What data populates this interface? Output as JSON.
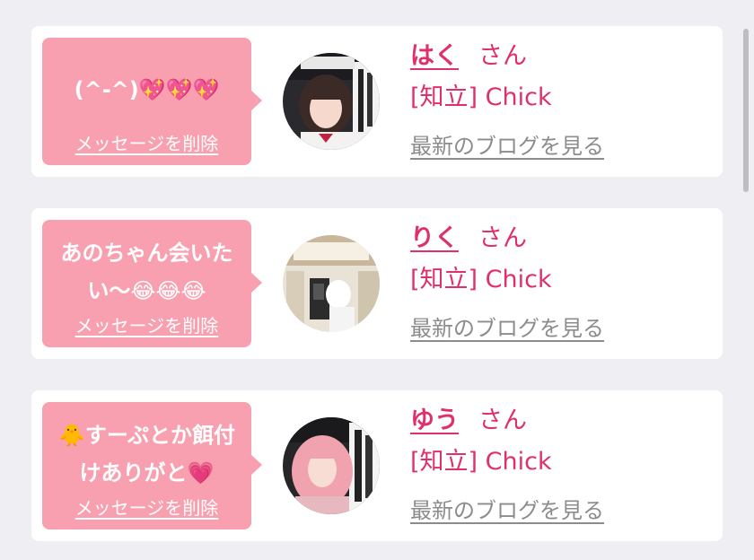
{
  "messages": [
    {
      "text": "(^-^)💖💖💖",
      "delete_label": "メッセージを削除",
      "name": "はく",
      "honorific": "さん",
      "shop": "[知立] Chick",
      "blog_label": "最新のブログを見る",
      "avatar_icon": "girl-portrait-photo"
    },
    {
      "text": "あのちゃん会いたい〜😂😂😂",
      "delete_label": "メッセージを削除",
      "name": "りく",
      "honorific": "さん",
      "shop": "[知立] Chick",
      "blog_label": "最新のブログを見る",
      "avatar_icon": "mirror-selfie-photo"
    },
    {
      "text": "🐥すーぷとか餌付けありがと💗",
      "delete_label": "メッセージを削除",
      "name": "ゆう",
      "honorific": "さん",
      "shop": "[知立] Chick",
      "blog_label": "最新のブログを見る",
      "avatar_icon": "pink-hair-girl-photo"
    }
  ],
  "colors": {
    "accent": "#e0306a",
    "bubble": "#f8a0b0",
    "background": "#efeff3",
    "muted_link": "#8c8c8c"
  }
}
